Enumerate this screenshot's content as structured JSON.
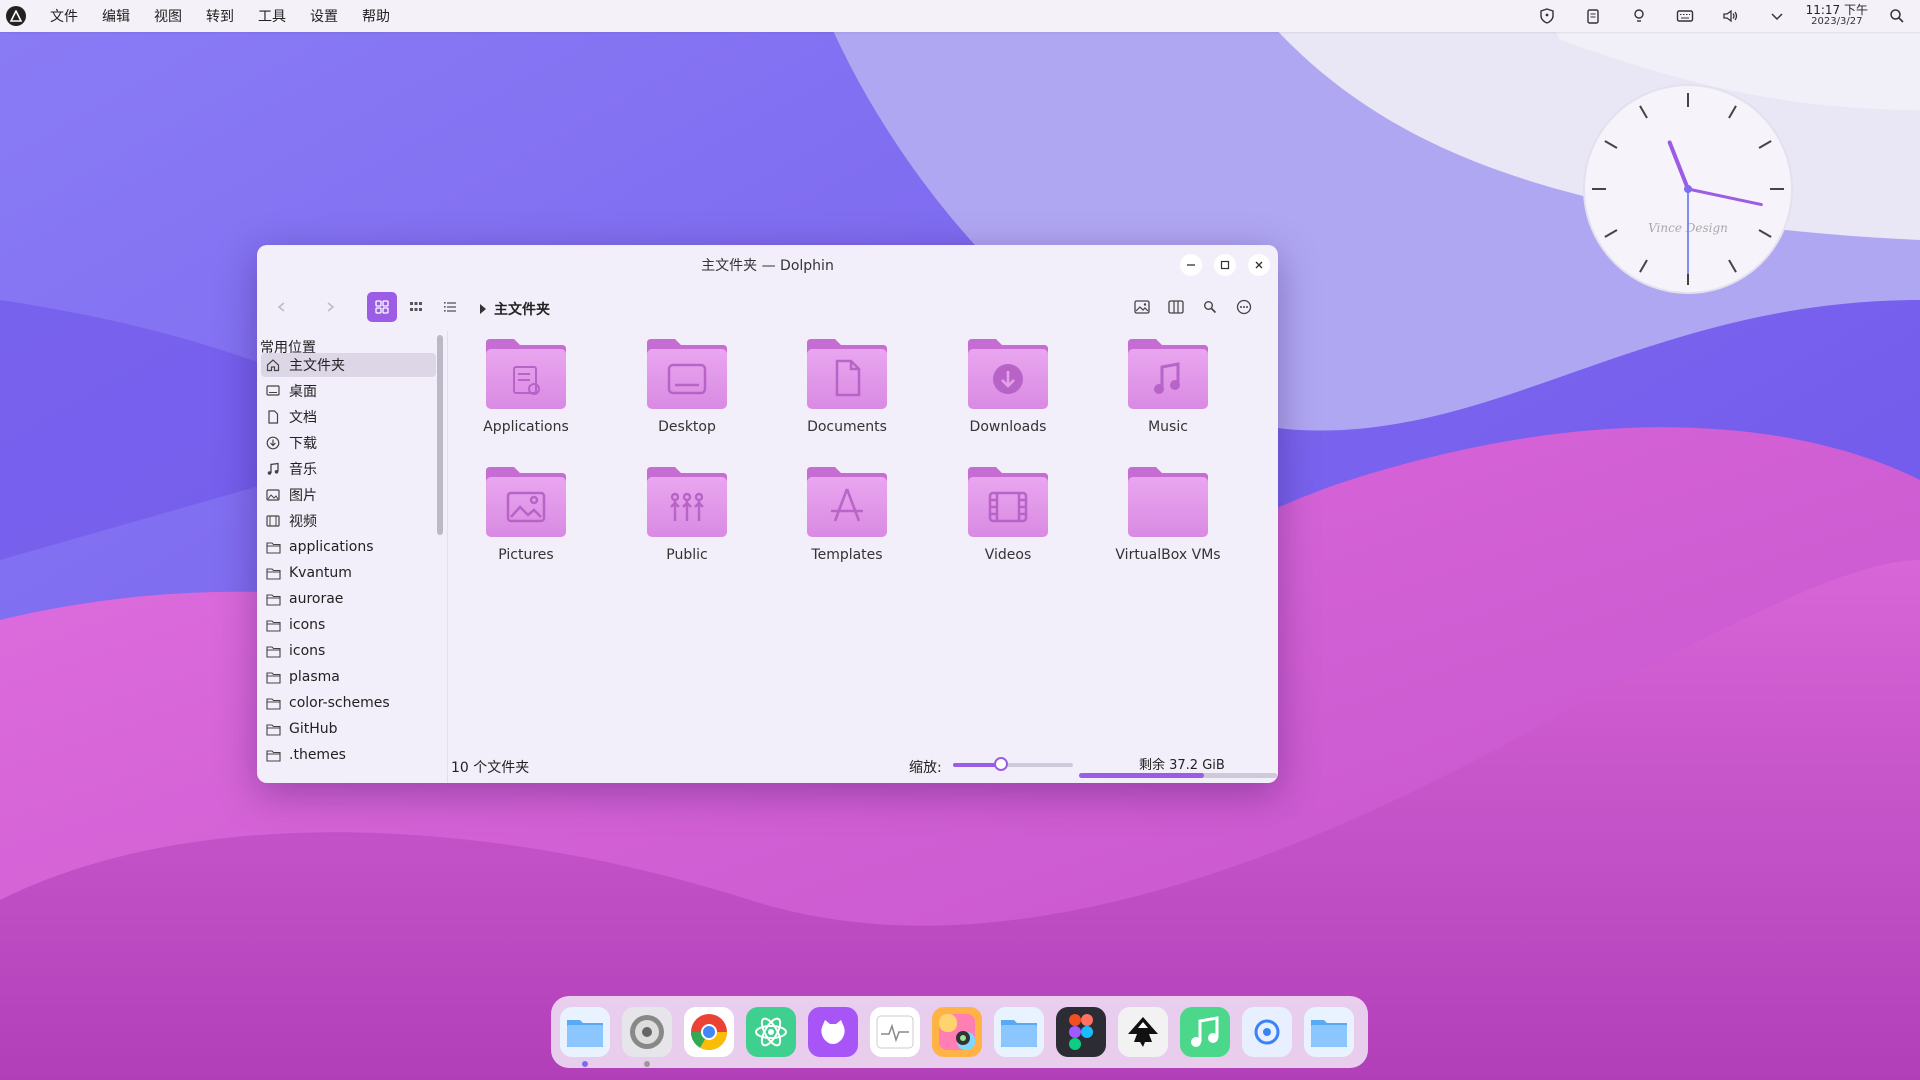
{
  "menubar": {
    "items": [
      "文件",
      "编辑",
      "视图",
      "转到",
      "工具",
      "设置",
      "帮助"
    ],
    "tray_icons": [
      "shield-icon",
      "clipboard-icon",
      "bulb-icon",
      "keyboard-icon",
      "volume-icon",
      "chevron-down-icon"
    ],
    "clock": {
      "time": "11:17 下午",
      "date": "2023/3/27"
    }
  },
  "clock_widget": {
    "brand": "Vince Design",
    "time": "11:17",
    "accent": "#9b5de5"
  },
  "window": {
    "title": "主文件夹 — Dolphin",
    "breadcrumb": "主文件夹",
    "sidebar": {
      "header": "常用位置",
      "items": [
        {
          "label": "主文件夹",
          "icon": "home-icon",
          "selected": true
        },
        {
          "label": "桌面",
          "icon": "desktop-icon"
        },
        {
          "label": "文档",
          "icon": "document-icon"
        },
        {
          "label": "下载",
          "icon": "download-icon"
        },
        {
          "label": "音乐",
          "icon": "music-icon"
        },
        {
          "label": "图片",
          "icon": "image-icon"
        },
        {
          "label": "视频",
          "icon": "video-icon"
        },
        {
          "label": "applications",
          "icon": "folder-icon"
        },
        {
          "label": "Kvantum",
          "icon": "folder-icon"
        },
        {
          "label": "aurorae",
          "icon": "folder-icon"
        },
        {
          "label": "icons",
          "icon": "folder-icon"
        },
        {
          "label": "icons",
          "icon": "folder-icon"
        },
        {
          "label": "plasma",
          "icon": "folder-icon"
        },
        {
          "label": "color-schemes",
          "icon": "folder-icon"
        },
        {
          "label": "GitHub",
          "icon": "folder-icon"
        },
        {
          "label": ".themes",
          "icon": "folder-icon"
        }
      ]
    },
    "files": [
      {
        "name": "Applications",
        "glyph": "apps"
      },
      {
        "name": "Desktop",
        "glyph": "desktop"
      },
      {
        "name": "Documents",
        "glyph": "doc"
      },
      {
        "name": "Downloads",
        "glyph": "download"
      },
      {
        "name": "Music",
        "glyph": "music"
      },
      {
        "name": "Pictures",
        "glyph": "picture"
      },
      {
        "name": "Public",
        "glyph": "people"
      },
      {
        "name": "Templates",
        "glyph": "template"
      },
      {
        "name": "Videos",
        "glyph": "video"
      },
      {
        "name": "VirtualBox VMs",
        "glyph": "none"
      }
    ],
    "status": {
      "count": "10 个文件夹",
      "zoom_label": "缩放:",
      "zoom_level": 0.4,
      "free_space": "剩余 37.2 GiB",
      "used_fraction": 0.63
    }
  },
  "dock": {
    "apps": [
      {
        "name": "files-app",
        "bg": "#e9f3ff",
        "running": true
      },
      {
        "name": "settings-app",
        "bg": "#e6e6ea",
        "running": true
      },
      {
        "name": "chrome-app",
        "bg": "#ffffff",
        "running": false
      },
      {
        "name": "atom-app",
        "bg": "#3fcf8e",
        "running": false
      },
      {
        "name": "github-app",
        "bg": "#a855f7",
        "running": false
      },
      {
        "name": "system-monitor-app",
        "bg": "#ffffff",
        "running": false
      },
      {
        "name": "photo-booth-app",
        "bg": "#ffb347",
        "running": false
      },
      {
        "name": "folder-app",
        "bg": "#e9f3ff",
        "running": false
      },
      {
        "name": "figma-app",
        "bg": "#2c2c34",
        "running": false
      },
      {
        "name": "inkscape-app",
        "bg": "#f2f2f2",
        "running": false
      },
      {
        "name": "music-app",
        "bg": "#4cd88a",
        "running": false
      },
      {
        "name": "browser-app",
        "bg": "#e8f0ff",
        "running": false
      },
      {
        "name": "folder2-app",
        "bg": "#e9f3ff",
        "running": false
      }
    ]
  }
}
